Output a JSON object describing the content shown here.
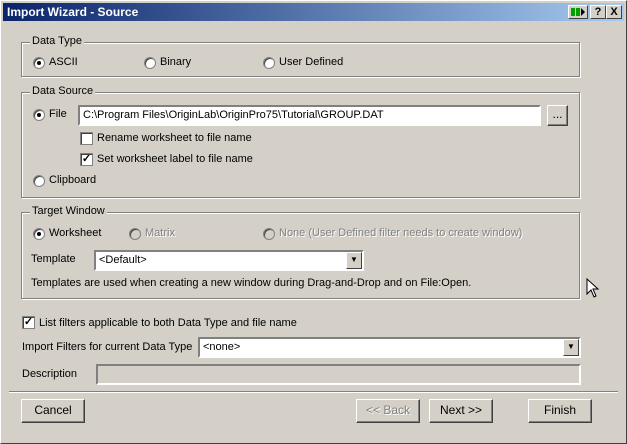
{
  "window": {
    "title": "Import Wizard - Source"
  },
  "data_type": {
    "label": "Data Type",
    "options": [
      "ASCII",
      "Binary",
      "User Defined"
    ],
    "selected": "ASCII"
  },
  "data_source": {
    "label": "Data Source",
    "file_label": "File",
    "file_path": "C:\\Program Files\\OriginLab\\OriginPro75\\Tutorial\\GROUP.DAT",
    "browse_label": "...",
    "rename_label": "Rename worksheet to file name",
    "rename_checked": false,
    "set_label_label": "Set worksheet label to file name",
    "set_label_checked": true,
    "clipboard_label": "Clipboard",
    "selected": "File"
  },
  "target_window": {
    "label": "Target Window",
    "options": [
      "Worksheet",
      "Matrix",
      "None (User Defined filter needs to create window)"
    ],
    "selected": "Worksheet",
    "template_label": "Template",
    "template_value": "<Default>",
    "note": "Templates are used when creating a new window during Drag-and-Drop and on File:Open."
  },
  "filters": {
    "list_label": "List filters applicable to both Data Type and file name",
    "list_checked": true,
    "import_label": "Import Filters for current Data Type",
    "import_value": "<none>",
    "description_label": "Description",
    "description_value": ""
  },
  "buttons": {
    "cancel": "Cancel",
    "back": "<< Back",
    "next": "Next >>",
    "finish": "Finish"
  },
  "titlebar_buttons": {
    "help": "?",
    "close": "X"
  }
}
